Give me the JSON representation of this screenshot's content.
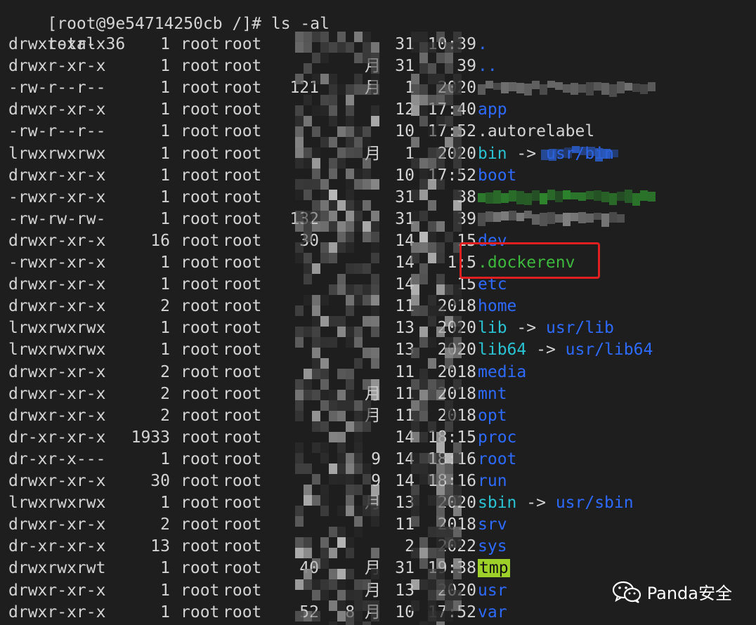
{
  "terminal": {
    "prompt_partial": "[root@9e54714250cb /]# ls -al",
    "total": "total 36",
    "rows": [
      {
        "perm": "drwxr-xr-x",
        "links": "1",
        "user": "root",
        "group": "root",
        "size": "",
        "month": "",
        "day": "31",
        "time": "10:39",
        "name": ".",
        "target": "",
        "kind": "dir"
      },
      {
        "perm": "drwxr-xr-x",
        "links": "1",
        "user": "root",
        "group": "root",
        "size": "",
        "month": "月",
        "day": "31",
        "time": "39",
        "name": "..",
        "target": "",
        "kind": "dir"
      },
      {
        "perm": "-rw-r--r--",
        "links": "1",
        "user": "root",
        "group": "root",
        "size": "121",
        "month": "月",
        "day": "1",
        "time": "2020",
        "name": "",
        "target": "",
        "kind": "plain"
      },
      {
        "perm": "drwxr-xr-x",
        "links": "1",
        "user": "root",
        "group": "root",
        "size": "",
        "month": "",
        "day": "12",
        "time": "17:40",
        "name": "app",
        "target": "",
        "kind": "dir"
      },
      {
        "perm": "-rw-r--r--",
        "links": "1",
        "user": "root",
        "group": "root",
        "size": "",
        "month": "",
        "day": "10",
        "time": "17:52",
        "name": ".autorelabel",
        "target": "",
        "kind": "plain"
      },
      {
        "perm": "lrwxrwxrwx",
        "links": "1",
        "user": "root",
        "group": "root",
        "size": "",
        "month": "月",
        "day": "1",
        "time": "2020",
        "name": "bin",
        "target": "usr/bin",
        "kind": "link"
      },
      {
        "perm": "drwxr-xr-x",
        "links": "1",
        "user": "root",
        "group": "root",
        "size": "",
        "month": "",
        "day": "10",
        "time": "17:52",
        "name": "boot",
        "target": "",
        "kind": "dir"
      },
      {
        "perm": "-rwxr-xr-x",
        "links": "1",
        "user": "root",
        "group": "root",
        "size": "",
        "month": "",
        "day": "31",
        "time": "38",
        "name": "",
        "target": "",
        "kind": "exec"
      },
      {
        "perm": "-rw-rw-rw-",
        "links": "1",
        "user": "root",
        "group": "root",
        "size": "132",
        "month": "",
        "day": "31",
        "time": "39",
        "name": "",
        "target": "",
        "kind": "plain"
      },
      {
        "perm": "drwxr-xr-x",
        "links": "16",
        "user": "root",
        "group": "root",
        "size": "30",
        "month": "",
        "day": "14",
        "time": "15",
        "name": "dev",
        "target": "",
        "kind": "dir"
      },
      {
        "perm": "-rwxr-xr-x",
        "links": "1",
        "user": "root",
        "group": "root",
        "size": "",
        "month": "",
        "day": "14",
        "time": "1:5",
        "name": ".dockerenv",
        "target": "",
        "kind": "exec"
      },
      {
        "perm": "drwxr-xr-x",
        "links": "1",
        "user": "root",
        "group": "root",
        "size": "",
        "month": "",
        "day": "14",
        "time": "15",
        "name": "etc",
        "target": "",
        "kind": "dir"
      },
      {
        "perm": "drwxr-xr-x",
        "links": "2",
        "user": "root",
        "group": "root",
        "size": "",
        "month": "",
        "day": "11",
        "time": "2018",
        "name": "home",
        "target": "",
        "kind": "dir"
      },
      {
        "perm": "lrwxrwxrwx",
        "links": "1",
        "user": "root",
        "group": "root",
        "size": "",
        "month": "",
        "day": "13",
        "time": "2020",
        "name": "lib",
        "target": "usr/lib",
        "kind": "link"
      },
      {
        "perm": "lrwxrwxrwx",
        "links": "1",
        "user": "root",
        "group": "root",
        "size": "",
        "month": "",
        "day": "13",
        "time": "2020",
        "name": "lib64",
        "target": "usr/lib64",
        "kind": "link"
      },
      {
        "perm": "drwxr-xr-x",
        "links": "2",
        "user": "root",
        "group": "root",
        "size": "",
        "month": "",
        "day": "11",
        "time": "2018",
        "name": "media",
        "target": "",
        "kind": "dir"
      },
      {
        "perm": "drwxr-xr-x",
        "links": "2",
        "user": "root",
        "group": "root",
        "size": "",
        "month": "月",
        "day": "11",
        "time": "2018",
        "name": "mnt",
        "target": "",
        "kind": "dir"
      },
      {
        "perm": "drwxr-xr-x",
        "links": "2",
        "user": "root",
        "group": "root",
        "size": "",
        "month": "月",
        "day": "11",
        "time": "2018",
        "name": "opt",
        "target": "",
        "kind": "dir"
      },
      {
        "perm": "dr-xr-xr-x",
        "links": "1933",
        "user": "root",
        "group": "root",
        "size": "",
        "month": "",
        "day": "14",
        "time": "18:15",
        "name": "proc",
        "target": "",
        "kind": "dir"
      },
      {
        "perm": "dr-xr-x---",
        "links": "1",
        "user": "root",
        "group": "root",
        "size": "",
        "month": "9",
        "day": "14",
        "time": "18:16",
        "name": "root",
        "target": "",
        "kind": "dir"
      },
      {
        "perm": "drwxr-xr-x",
        "links": "30",
        "user": "root",
        "group": "root",
        "size": "",
        "month": "9",
        "day": "14",
        "time": "18:16",
        "name": "run",
        "target": "",
        "kind": "dir"
      },
      {
        "perm": "lrwxrwxrwx",
        "links": "1",
        "user": "root",
        "group": "root",
        "size": "",
        "month": "月",
        "day": "13",
        "time": "2020",
        "name": "sbin",
        "target": "usr/sbin",
        "kind": "link"
      },
      {
        "perm": "drwxr-xr-x",
        "links": "2",
        "user": "root",
        "group": "root",
        "size": "",
        "month": "",
        "day": "11",
        "time": "2018",
        "name": "srv",
        "target": "",
        "kind": "dir"
      },
      {
        "perm": "dr-xr-xr-x",
        "links": "13",
        "user": "root",
        "group": "root",
        "size": "",
        "month": "",
        "day": "2",
        "time": "2022",
        "name": "sys",
        "target": "",
        "kind": "dir"
      },
      {
        "perm": "drwxrwxrwt",
        "links": "1",
        "user": "root",
        "group": "root",
        "size": "40",
        "month": "月",
        "day": "31",
        "time": "19:38",
        "name": "tmp",
        "target": "",
        "kind": "sticky"
      },
      {
        "perm": "drwxr-xr-x",
        "links": "1",
        "user": "root",
        "group": "root",
        "size": "",
        "month": "月",
        "day": "13",
        "time": "2020",
        "name": "usr",
        "target": "",
        "kind": "dir"
      },
      {
        "perm": "drwxr-xr-x",
        "links": "1",
        "user": "root",
        "group": "root",
        "size": "52",
        "month": "8 月",
        "day": "10",
        "time": "17:52",
        "name": "var",
        "target": "",
        "kind": "dir"
      }
    ],
    "arrow": "->"
  },
  "watermark": {
    "text": "Panda安全",
    "icon": "wechat-icon"
  },
  "colors": {
    "background": "#1e1e1e",
    "text": "#d4d4d4",
    "directory": "#2d6bff",
    "symlink": "#29c3d4",
    "executable": "#3dba3d",
    "sticky_bg": "#9ed02a",
    "highlight": "#e02020"
  }
}
